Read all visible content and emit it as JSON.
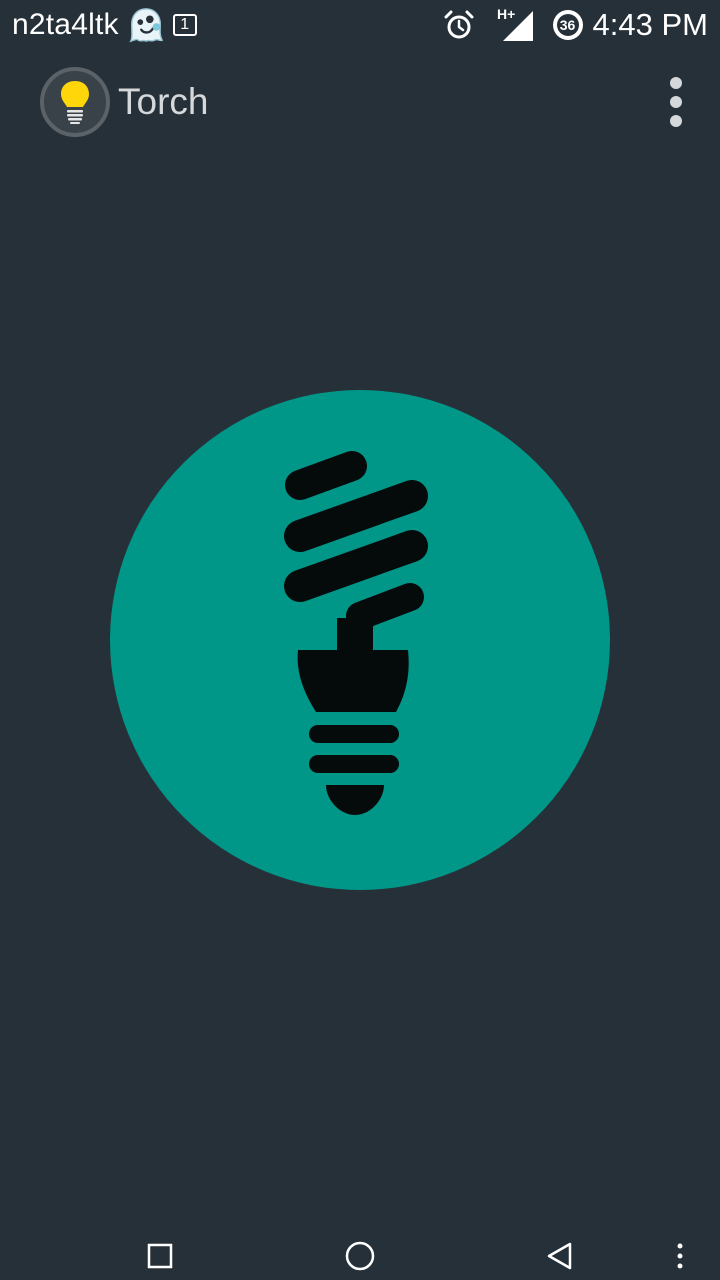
{
  "status_bar": {
    "carrier": "n2ta4ltk",
    "notification_count": "1",
    "network_type": "H+",
    "battery_level": "36",
    "time": "4:43 PM"
  },
  "app_bar": {
    "title": "Torch"
  },
  "icons": {
    "app_logo": "lightbulb-icon",
    "main_button": "cfl-bulb-icon",
    "overflow": "more-vert-icon"
  },
  "colors": {
    "background": "#263038",
    "accent": "#009688",
    "bulb_yellow": "#ffd60a"
  }
}
